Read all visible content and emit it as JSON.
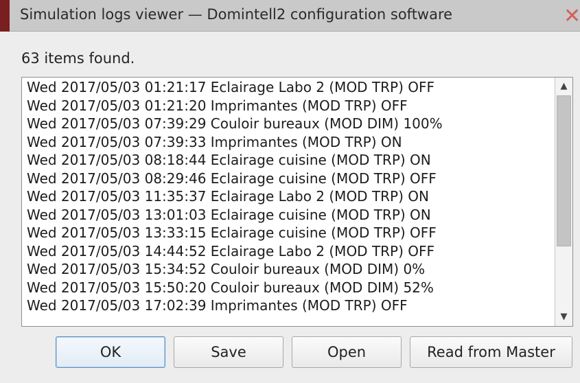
{
  "window": {
    "title": "Simulation logs viewer — Domintell2 configuration software",
    "close_glyph": "✕"
  },
  "summary": {
    "count_text": "63 items found."
  },
  "log_list": {
    "rows": [
      "Wed 2017/05/03 01:21:17 Eclairage Labo 2 (MOD TRP) OFF",
      "Wed 2017/05/03 01:21:20 Imprimantes (MOD TRP) OFF",
      "Wed 2017/05/03 07:39:29 Couloir bureaux (MOD DIM) 100%",
      "Wed 2017/05/03 07:39:33 Imprimantes (MOD TRP) ON",
      "Wed 2017/05/03 08:18:44 Eclairage cuisine (MOD TRP) ON",
      "Wed 2017/05/03 08:29:46 Eclairage cuisine (MOD TRP) OFF",
      "Wed 2017/05/03 11:35:37 Eclairage Labo 2 (MOD TRP) ON",
      "Wed 2017/05/03 13:01:03 Eclairage cuisine (MOD TRP) ON",
      "Wed 2017/05/03 13:33:15 Eclairage cuisine (MOD TRP) OFF",
      "Wed 2017/05/03 14:44:52 Eclairage Labo 2 (MOD TRP) OFF",
      "Wed 2017/05/03 15:34:52 Couloir bureaux (MOD DIM) 0%",
      "Wed 2017/05/03 15:50:20 Couloir bureaux (MOD DIM) 52%",
      "Wed 2017/05/03 17:02:39 Imprimantes (MOD TRP) OFF"
    ],
    "scroll_up_glyph": "▲",
    "scroll_down_glyph": "▼"
  },
  "buttons": {
    "ok": "OK",
    "save": "Save",
    "open": "Open",
    "read_from_master": "Read from Master"
  },
  "colors": {
    "titlebar_bg": "#c9c9c9",
    "window_bg": "#ededed",
    "close_icon": "#d5605a",
    "default_button_border": "#5b8fc4"
  }
}
